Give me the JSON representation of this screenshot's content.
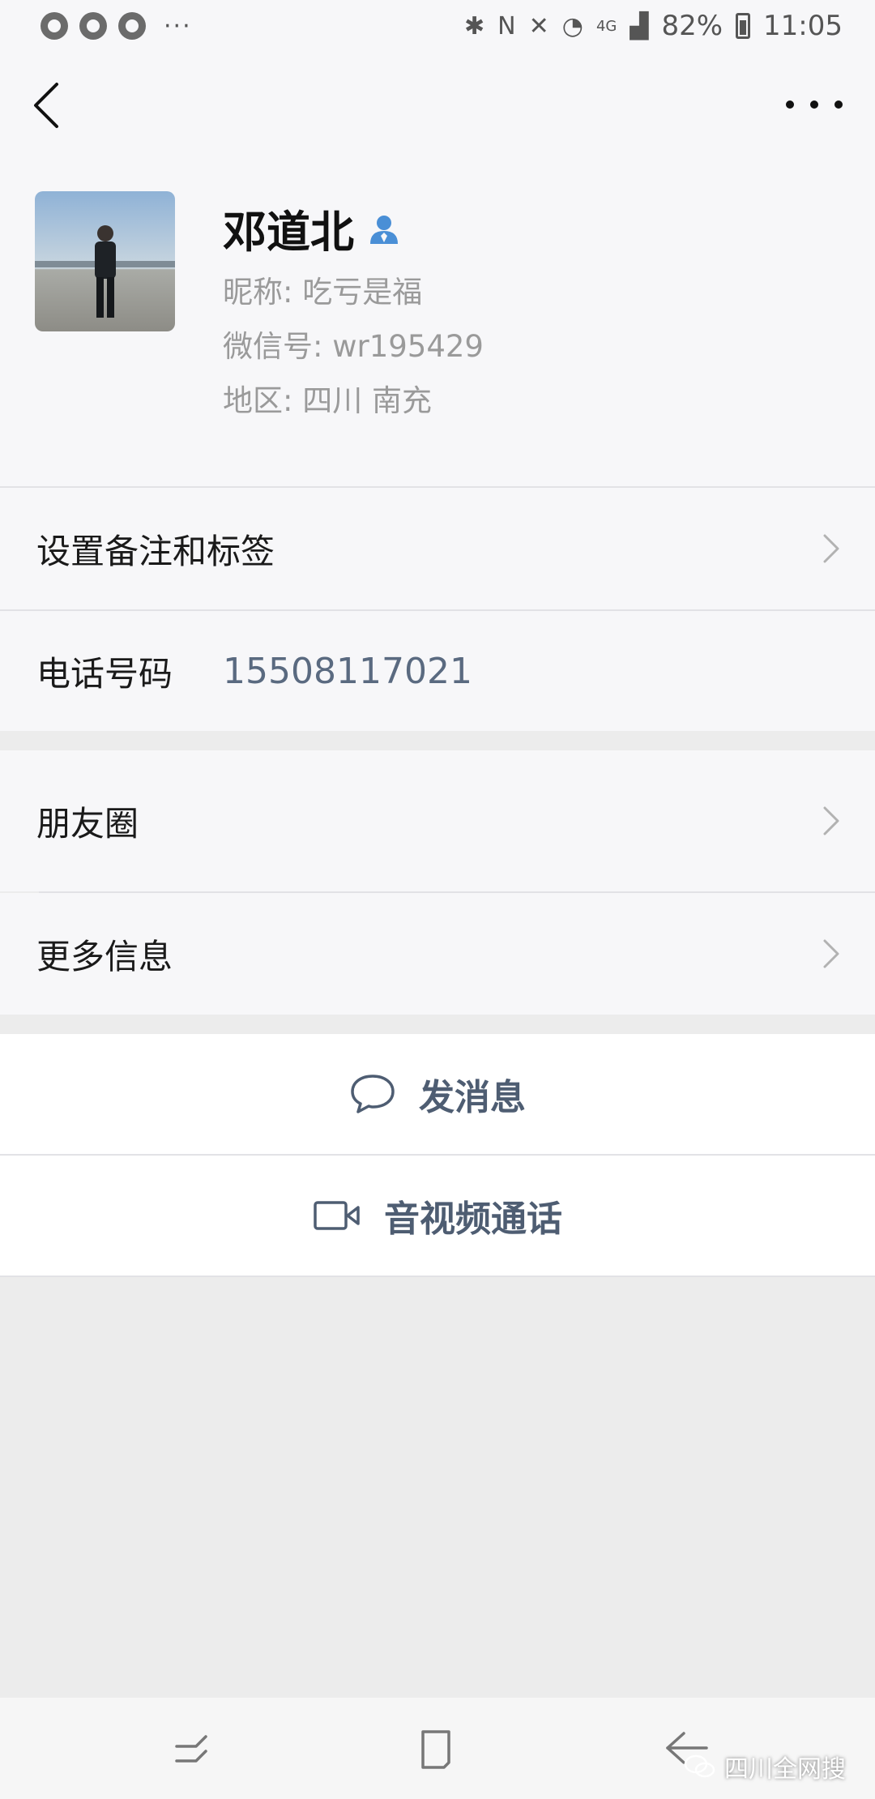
{
  "status_bar": {
    "battery": "82%",
    "time": "11:05",
    "network": "4G",
    "dots": "···"
  },
  "header": {
    "back_icon": "chevron-left-icon",
    "more_icon": "more-dots-icon"
  },
  "profile": {
    "name": "邓道北",
    "nickname": "昵称: 吃亏是福",
    "wechat_id": "微信号: wr195429",
    "region": "地区: 四川  南充"
  },
  "rows": {
    "remark_tags": "设置备注和标签",
    "phone_label": "电话号码",
    "phone_value": "15508117021",
    "moments": "朋友圈",
    "more_info": "更多信息"
  },
  "actions": {
    "send_message": "发消息",
    "av_call": "音视频通话"
  },
  "watermark": "四川全网搜",
  "colors": {
    "accent_blue": "#4a8fd6",
    "action_text": "#4e5d72",
    "phone_text": "#5a6a80"
  }
}
